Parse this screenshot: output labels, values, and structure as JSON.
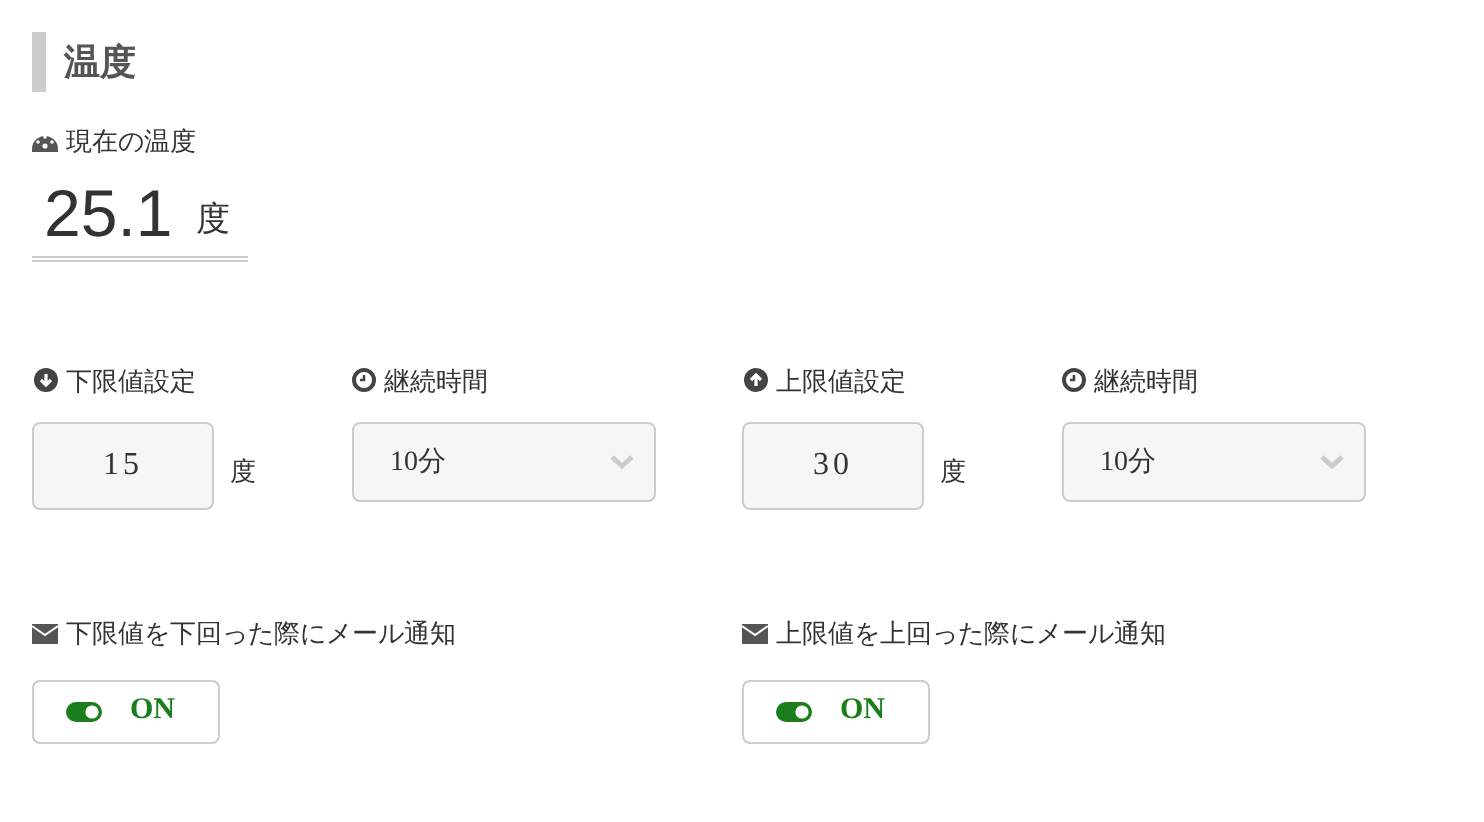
{
  "title": "温度",
  "current": {
    "label": "現在の温度",
    "value": "25.1",
    "unit": "度"
  },
  "limits": [
    {
      "kind": "lower",
      "label": "下限値設定",
      "value": "15",
      "unit": "度",
      "duration_label": "継続時間",
      "duration_value": "10分"
    },
    {
      "kind": "upper",
      "label": "上限値設定",
      "value": "30",
      "unit": "度",
      "duration_label": "継続時間",
      "duration_value": "10分"
    }
  ],
  "notifications": [
    {
      "label": "下限値を下回った際にメール通知",
      "on": true,
      "status": "ON"
    },
    {
      "label": "上限値を上回った際にメール通知",
      "on": true,
      "status": "ON"
    }
  ]
}
